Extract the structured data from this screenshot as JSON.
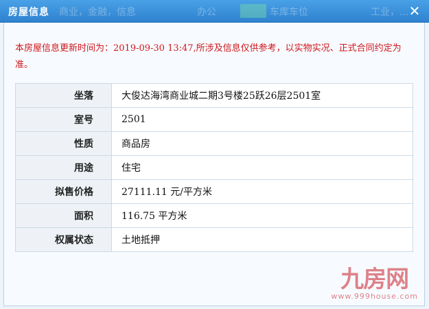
{
  "window": {
    "title": "房屋信息",
    "background_menu": [
      "商业，金融，信息",
      "办公",
      "车库车位",
      "工业，..."
    ],
    "close_glyph": "✕",
    "accent_color": "#2f82cf"
  },
  "notice": {
    "text": "本房屋信息更新时间为：2019-09-30 13:47,所涉及信息仅供参考，以实物实况、正式合同约定为准。",
    "color": "#d0161b"
  },
  "property": {
    "rows": [
      {
        "label": "坐落",
        "value": "大俊达海湾商业城二期3号楼25跃26层2501室"
      },
      {
        "label": "室号",
        "value": "2501"
      },
      {
        "label": "性质",
        "value": "商品房"
      },
      {
        "label": "用途",
        "value": "住宅"
      },
      {
        "label": "拟售价格",
        "value": "27111.11 元/平方米"
      },
      {
        "label": "面积",
        "value": "116.75 平方米"
      },
      {
        "label": "权属状态",
        "value": "土地抵押"
      }
    ]
  },
  "watermark": {
    "logo": "九房网",
    "url": "www.999house.com"
  }
}
